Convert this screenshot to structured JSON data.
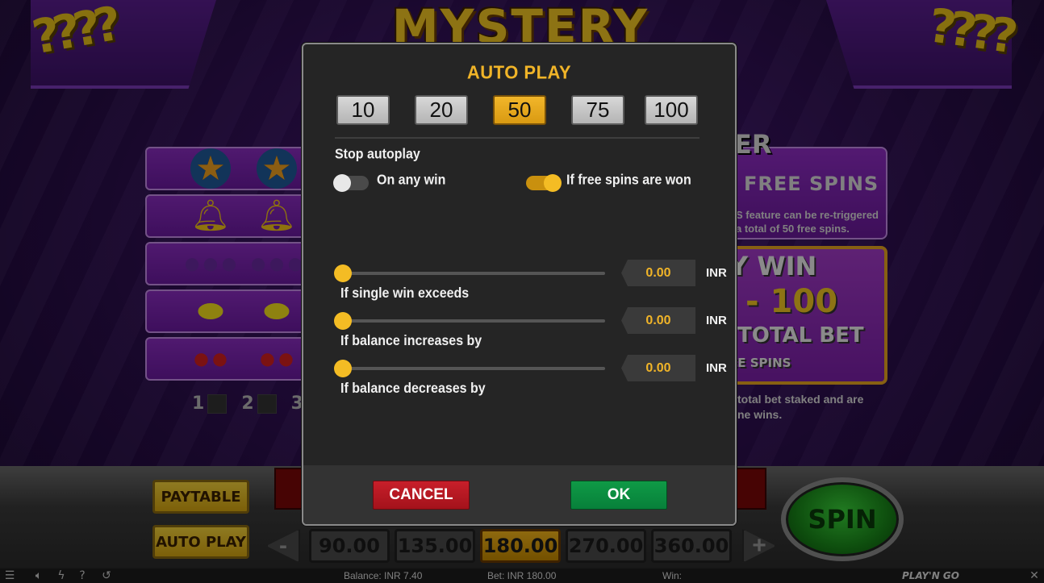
{
  "game": {
    "logo_text": "MYSTERY JOKER",
    "paytable_button": "PAYTABLE",
    "autoplay_button": "AUTO PLAY",
    "spin_button": "SPIN",
    "line_numbers": [
      "1",
      "2",
      "3"
    ],
    "info_panel": {
      "title_fragment": "ER",
      "free_spins": "FREE SPINS",
      "note_line1": "S feature can be re-triggered",
      "note_line2": "a total of 50 free spins.",
      "big1": "Y WIN",
      "big2": "- 100",
      "big3": "TOTAL BET",
      "big4": "EE SPINS",
      "foot_line1": "total bet staked and are",
      "foot_line2": "ne wins."
    },
    "bet_values": [
      "90.00",
      "135.00",
      "180.00",
      "270.00",
      "360.00"
    ],
    "selected_bet_index": 2,
    "bet_minus": "-",
    "bet_plus": "+"
  },
  "status_bar": {
    "balance": "Balance: INR 7.40",
    "bet": "Bet: INR 180.00",
    "win": "Win:",
    "brand": "PLAY'N GO",
    "icons": [
      "menu-icon",
      "speaker-icon",
      "lightning-icon",
      "help-icon",
      "history-icon",
      "close-icon"
    ]
  },
  "autoplay_dialog": {
    "title": "AUTO PLAY",
    "counts": [
      "10",
      "20",
      "50",
      "75",
      "100"
    ],
    "selected_count_index": 2,
    "stop_autoplay_label": "Stop autoplay",
    "toggles": [
      {
        "label": "On any win",
        "on": false
      },
      {
        "label": "If free spins are won",
        "on": true
      }
    ],
    "sliders": [
      {
        "label": "If single win exceeds",
        "value": "0.00",
        "unit": "INR"
      },
      {
        "label": "If balance increases by",
        "value": "0.00",
        "unit": "INR"
      },
      {
        "label": "If balance decreases by",
        "value": "0.00",
        "unit": "INR"
      }
    ],
    "cancel_label": "CANCEL",
    "ok_label": "OK"
  },
  "colors": {
    "accent": "#f0b428",
    "cancel": "#c81f2a",
    "ok": "#0f9a46",
    "dialog_bg": "#252525"
  }
}
